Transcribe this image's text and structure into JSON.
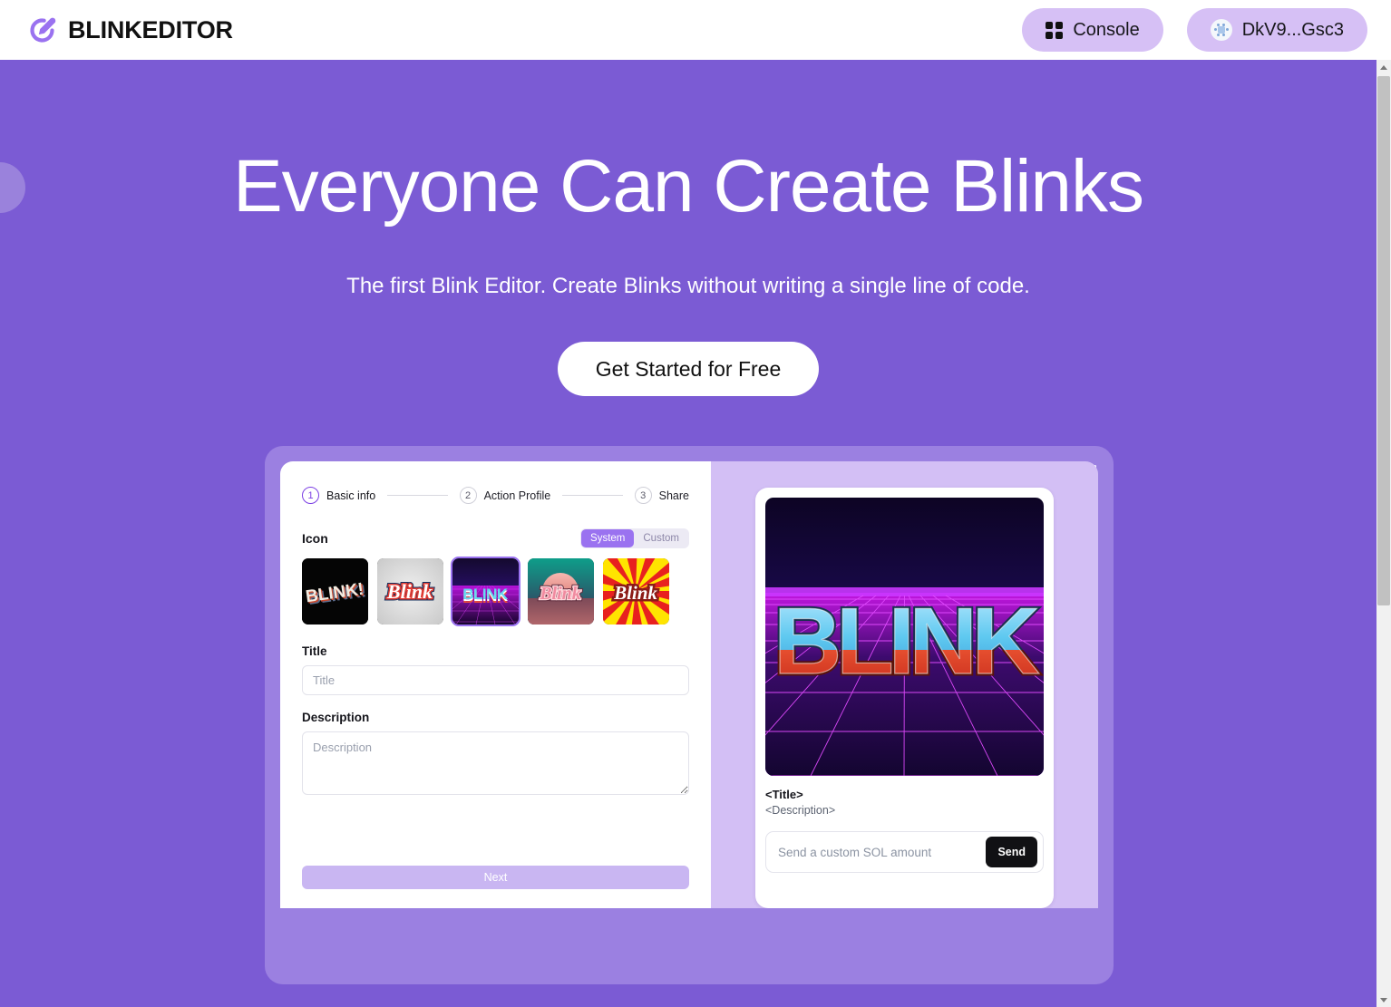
{
  "header": {
    "brand_name": "BLINKEDITOR",
    "logo_icon": "pencil-edit-icon",
    "console_button": {
      "label": "Console",
      "icon": "grid-icon"
    },
    "wallet_button": {
      "label": "DkV9...Gsc3",
      "icon": "wallet-avatar-icon"
    }
  },
  "hero": {
    "title": "Everyone Can Create Blinks",
    "subtitle": "The first Blink Editor. Create Blinks without writing a single line of code.",
    "cta_label": "Get Started for Free"
  },
  "editor": {
    "steps": [
      {
        "num": "1",
        "label": "Basic info",
        "active": true
      },
      {
        "num": "2",
        "label": "Action Profile",
        "active": false
      },
      {
        "num": "3",
        "label": "Share",
        "active": false
      }
    ],
    "icon_section": {
      "label": "Icon",
      "source_options": [
        "System",
        "Custom"
      ],
      "selected_source": "System",
      "thumbs": [
        {
          "name": "blink-black-3d",
          "caption": "BLINK!"
        },
        {
          "name": "blink-retro-grey",
          "caption": "Blink"
        },
        {
          "name": "blink-synthwave",
          "caption": "BLINK"
        },
        {
          "name": "blink-sunset-teal",
          "caption": "Blink"
        },
        {
          "name": "blink-sunburst-yellow",
          "caption": "Blink"
        }
      ],
      "selected_thumb_index": 2
    },
    "title_field": {
      "label": "Title",
      "placeholder": "Title",
      "value": ""
    },
    "description_field": {
      "label": "Description",
      "placeholder": "Description",
      "value": ""
    },
    "next_label": "Next"
  },
  "preview": {
    "art_alt": "blink-synthwave-artwork",
    "art_text": "BLINK",
    "title": "<Title>",
    "description": "<Description>",
    "amount_placeholder": "Send a custom SOL amount",
    "amount_value": "",
    "send_label": "Send"
  },
  "colors": {
    "hero_background": "#7B5BD4",
    "showcase_frame": "#9B80E1",
    "preview_background": "#D3BFF5",
    "accent_purple": "#9A72F0",
    "pill_purple": "#D6C0F5",
    "next_button": "#C9B6F2",
    "step_active": "#7B3FE4"
  }
}
